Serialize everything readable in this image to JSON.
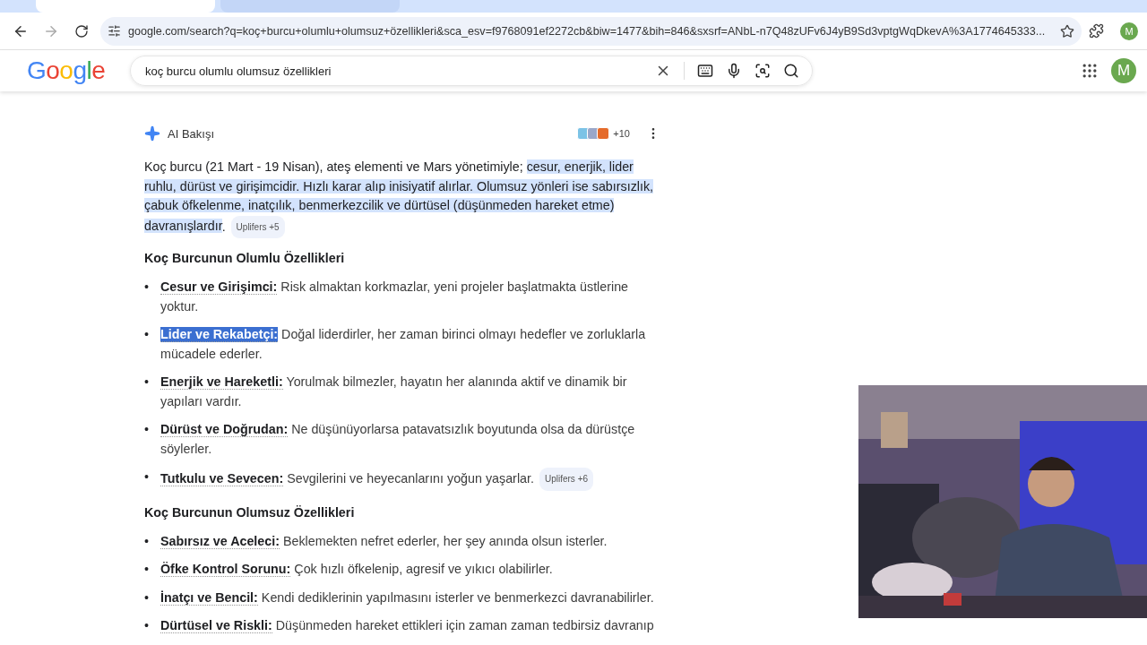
{
  "browser": {
    "tabs": [
      {
        "selected": true
      },
      {
        "selected": false
      }
    ],
    "url": "google.com/search?q=koç+burcu+olumlu+olumsuz+özellikleri&sca_esv=f9768091ef2272cb&biw=1477&bih=846&sxsrf=ANbL-n7Q48zUFv6J4yB9Sd3vptgWqDkevA%3A1774645333...",
    "profile_initial": "M"
  },
  "search": {
    "logo": "Google",
    "query": "koç burcu olumlu olumsuz özellikleri",
    "avatar_initial": "M"
  },
  "ai_overview": {
    "title": "AI Bakışı",
    "sources_count": "+10",
    "summary": [
      {
        "text": "Koç burcu (21 Mart - 19 Nisan), ateş elementi ve Mars yönetimiyle; ",
        "highlighted": false
      },
      {
        "text": "cesur, enerjik, lider ruhlu, dürüst ve girişimcidir. Hızlı karar alıp inisiyatif alırlar. Olumsuz yönleri ise sabırsızlık, çabuk öfkelenme, inatçılık, benmerkezcilik ve dürtüsel (düşünmeden hareket etme) davranışlardır",
        "highlighted": true
      },
      {
        "text": ".",
        "highlighted": false
      }
    ],
    "summary_chip": "Uplifers +5",
    "sections": [
      {
        "heading": "Koç Burcunun Olumlu Özellikleri",
        "items": [
          {
            "marker": "•",
            "term": "Cesur ve Girişimci:",
            "text": "Risk almaktan korkmazlar, yeni projeler başlatmakta üstlerine yoktur.",
            "selected": false
          },
          {
            "marker": "•",
            "term": "Lider ve Rekabetçi:",
            "text": "Doğal liderdirler, her zaman birinci olmayı hedefler ve zorluklarla mücadele ederler.",
            "selected": true
          },
          {
            "marker": "•",
            "term": "Enerjik ve Hareketli:",
            "text": "Yorulmak bilmezler, hayatın her alanında aktif ve dinamik bir yapıları vardır.",
            "selected": false
          },
          {
            "marker": "•",
            "term": "Dürüst ve Doğrudan:",
            "text": "Ne düşünüyorlarsa patavatsızlık boyutunda olsa da dürüstçe söylerler.",
            "selected": false
          },
          {
            "marker": "•",
            "term": "Tutkulu ve Sevecen:",
            "text": "Sevgilerini ve heyecanlarını yoğun yaşarlar.",
            "selected": false,
            "chip": "Uplifers +6"
          }
        ]
      },
      {
        "heading": "Koç Burcunun Olumsuz Özellikleri",
        "items": [
          {
            "marker": "•",
            "term": "Sabırsız ve Aceleci:",
            "text": "Beklemekten nefret ederler, her şey anında olsun isterler.",
            "selected": false
          },
          {
            "marker": "•",
            "term": "Öfke Kontrol Sorunu:",
            "text": "Çok hızlı öfkelenip, agresif ve yıkıcı olabilirler.",
            "selected": false
          },
          {
            "marker": "•",
            "term": "İnatçı ve Bencil:",
            "text": "Kendi dediklerinin yapılmasını isterler ve benmerkezci davranabilirler.",
            "selected": false
          },
          {
            "marker": "•",
            "term": "Dürtüsel ve Riskli:",
            "text": "Düşünmeden hareket ettikleri için zaman zaman tedbirsiz davranıp",
            "selected": false
          }
        ]
      }
    ]
  }
}
